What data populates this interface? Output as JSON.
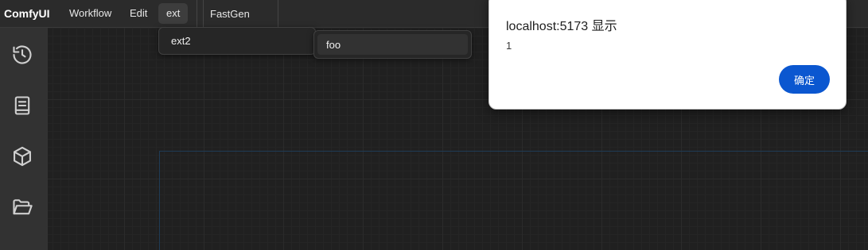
{
  "topbar": {
    "brand": "ComfyUI",
    "menu": [
      "Workflow",
      "Edit",
      "ext"
    ],
    "tab": "FastGen"
  },
  "sidebar": {
    "icons": [
      "history-icon",
      "book-icon",
      "cube-icon",
      "folder-open-icon"
    ]
  },
  "submenu": {
    "level1": [
      "ext2"
    ],
    "level2": [
      "foo"
    ]
  },
  "dialog": {
    "title": "localhost:5173 显示",
    "message": "1",
    "ok_label": "确定"
  },
  "colors": {
    "accent": "#0b57d0",
    "background": "#222222",
    "sidebar": "#323232",
    "topbar": "#2b2b2b"
  }
}
